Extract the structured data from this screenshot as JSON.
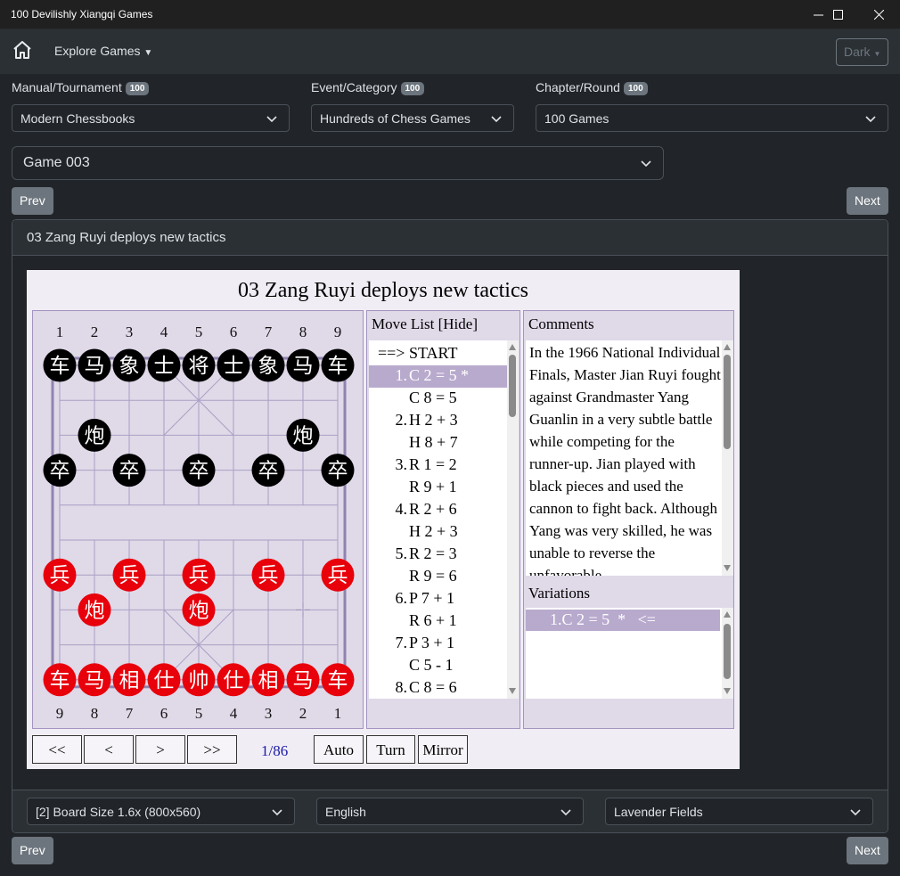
{
  "window": {
    "title": "100 Devilishly Xiangqi Games",
    "min": "—",
    "max": "☐",
    "close": "✕"
  },
  "nav": {
    "explore": "Explore Games",
    "theme": "Dark"
  },
  "filters": {
    "manual_label": "Manual/Tournament",
    "manual_count": "100",
    "manual_value": "Modern Chessbooks",
    "event_label": "Event/Category",
    "event_count": "100",
    "event_value": "Hundreds of Chess Games",
    "chapter_label": "Chapter/Round",
    "chapter_count": "100",
    "chapter_value": "100 Games",
    "game_value": "Game 003"
  },
  "buttons": {
    "prev": "Prev",
    "next": "Next"
  },
  "card": {
    "header": "03 Zang Ruyi deploys new tactics"
  },
  "board": {
    "title": "03 Zang Ruyi deploys new tactics",
    "top_files": [
      "1",
      "2",
      "3",
      "4",
      "5",
      "6",
      "7",
      "8",
      "9"
    ],
    "bottom_files": [
      "9",
      "8",
      "7",
      "6",
      "5",
      "4",
      "3",
      "2",
      "1"
    ],
    "black_pieces": [
      {
        "c": "车",
        "f": 0,
        "r": 0
      },
      {
        "c": "马",
        "f": 1,
        "r": 0
      },
      {
        "c": "象",
        "f": 2,
        "r": 0
      },
      {
        "c": "士",
        "f": 3,
        "r": 0
      },
      {
        "c": "将",
        "f": 4,
        "r": 0
      },
      {
        "c": "士",
        "f": 5,
        "r": 0
      },
      {
        "c": "象",
        "f": 6,
        "r": 0
      },
      {
        "c": "马",
        "f": 7,
        "r": 0
      },
      {
        "c": "车",
        "f": 8,
        "r": 0
      },
      {
        "c": "炮",
        "f": 1,
        "r": 2
      },
      {
        "c": "炮",
        "f": 7,
        "r": 2
      },
      {
        "c": "卒",
        "f": 0,
        "r": 3
      },
      {
        "c": "卒",
        "f": 2,
        "r": 3
      },
      {
        "c": "卒",
        "f": 4,
        "r": 3
      },
      {
        "c": "卒",
        "f": 6,
        "r": 3
      },
      {
        "c": "卒",
        "f": 8,
        "r": 3
      }
    ],
    "red_pieces": [
      {
        "c": "兵",
        "f": 0,
        "r": 6
      },
      {
        "c": "兵",
        "f": 2,
        "r": 6
      },
      {
        "c": "兵",
        "f": 4,
        "r": 6
      },
      {
        "c": "兵",
        "f": 6,
        "r": 6
      },
      {
        "c": "兵",
        "f": 8,
        "r": 6
      },
      {
        "c": "炮",
        "f": 1,
        "r": 7
      },
      {
        "c": "炮",
        "f": 4,
        "r": 7
      },
      {
        "c": "车",
        "f": 0,
        "r": 9
      },
      {
        "c": "马",
        "f": 1,
        "r": 9
      },
      {
        "c": "相",
        "f": 2,
        "r": 9
      },
      {
        "c": "仕",
        "f": 3,
        "r": 9
      },
      {
        "c": "帅",
        "f": 4,
        "r": 9
      },
      {
        "c": "仕",
        "f": 5,
        "r": 9
      },
      {
        "c": "相",
        "f": 6,
        "r": 9
      },
      {
        "c": "马",
        "f": 7,
        "r": 9
      },
      {
        "c": "车",
        "f": 8,
        "r": 9
      }
    ],
    "colors": {
      "board": "#e0d9e8",
      "lines": "#a9a0c4",
      "black": "#000000",
      "red": "#e8000b"
    }
  },
  "movelist": {
    "title": "Move List [Hide]",
    "start": "==> START",
    "moves": [
      {
        "n": "1.",
        "m": "C 2 = 5 *"
      },
      {
        "n": "",
        "m": "C 8 = 5"
      },
      {
        "n": "2.",
        "m": "H 2 + 3"
      },
      {
        "n": "",
        "m": "H 8 + 7"
      },
      {
        "n": "3.",
        "m": "R 1 = 2"
      },
      {
        "n": "",
        "m": "R 9 + 1"
      },
      {
        "n": "4.",
        "m": "R 2 + 6"
      },
      {
        "n": "",
        "m": "H 2 + 3"
      },
      {
        "n": "5.",
        "m": "R 2 = 3"
      },
      {
        "n": "",
        "m": "R 9 = 6"
      },
      {
        "n": "6.",
        "m": "P 7 + 1"
      },
      {
        "n": "",
        "m": "R 6 + 1"
      },
      {
        "n": "7.",
        "m": "P 3 + 1"
      },
      {
        "n": "",
        "m": "C 5 - 1"
      },
      {
        "n": "8.",
        "m": "C 8 = 6"
      }
    ]
  },
  "comments": {
    "title": "Comments",
    "text": "In the 1966 National Individual Finals, Master Jian Ruyi fought against Grandmaster Yang Guanlin in a very subtle battle while competing for the runner-up. Jian played with black pieces and used the cannon to fight back. Although Yang was very skilled, he was unable to reverse the unfavorable"
  },
  "variations": {
    "title": "Variations",
    "item": "1.C 2 = 5  *   <="
  },
  "controls": {
    "first": "<<",
    "prev": "<",
    "next": ">",
    "last": ">>",
    "counter": "1/86",
    "auto": "Auto",
    "turn": "Turn",
    "mirror": "Mirror"
  },
  "footer": {
    "board_size": "[2] Board Size 1.6x (800x560)",
    "language": "English",
    "theme": "Lavender Fields"
  }
}
